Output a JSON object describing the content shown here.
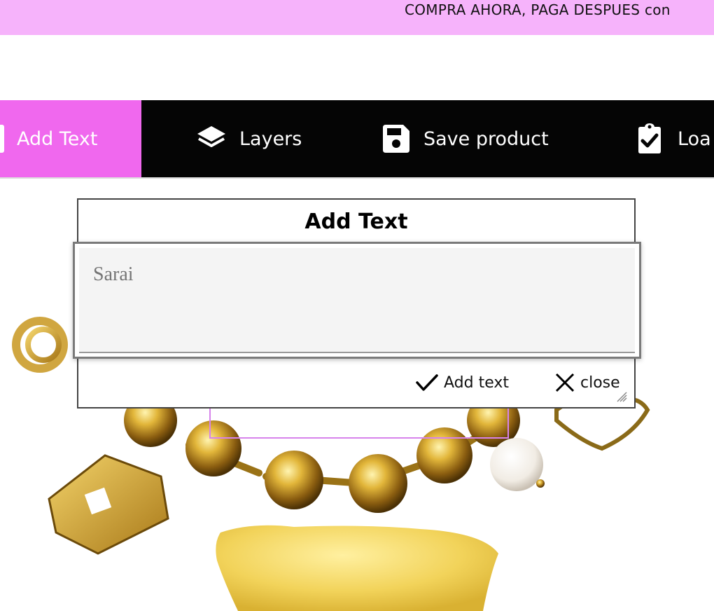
{
  "promo": {
    "text": "COMPRA AHORA, PAGA DESPUES con"
  },
  "toolbar": {
    "items": [
      {
        "label": "Add Text",
        "icon": "add-text-icon",
        "active": true
      },
      {
        "label": "Layers",
        "icon": "layers-icon"
      },
      {
        "label": "Save product",
        "icon": "save-icon"
      },
      {
        "label": "Loa",
        "icon": "clipboard-check-icon"
      }
    ],
    "active_color": "#f068ee",
    "background": "#050505"
  },
  "dialog": {
    "title": "Add Text",
    "input_placeholder": "Sarai",
    "add_label": "Add text",
    "close_label": "close"
  },
  "colors": {
    "promo_bar": "#f6b3fb",
    "selection": "#d783eb"
  }
}
